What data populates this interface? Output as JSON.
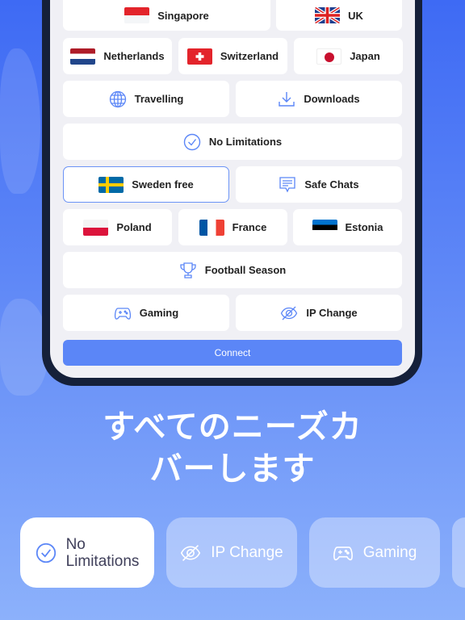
{
  "tiles": {
    "singapore": "Singapore",
    "uk": "UK",
    "netherlands": "Netherlands",
    "switzerland": "Switzerland",
    "japan": "Japan",
    "travelling": "Travelling",
    "downloads": "Downloads",
    "no_limitations": "No Limitations",
    "sweden": "Sweden free",
    "safe_chats": "Safe Chats",
    "poland": "Poland",
    "france": "France",
    "estonia": "Estonia",
    "football": "Football Season",
    "gaming": "Gaming",
    "ip_change": "IP Change"
  },
  "connect_label": "Connect",
  "headline": [
    "すべてのニーズカ",
    "バーします"
  ],
  "cards": [
    {
      "label_line1": "No",
      "label_line2": "Limitations",
      "icon": "check-circle-icon",
      "active": true
    },
    {
      "label": "IP Change",
      "icon": "eye-slash-icon",
      "active": false
    },
    {
      "label": "Gaming",
      "icon": "gamepad-icon",
      "active": false
    }
  ],
  "colors": {
    "accent": "#5b86f7",
    "selected_border": "#6b93f6"
  }
}
